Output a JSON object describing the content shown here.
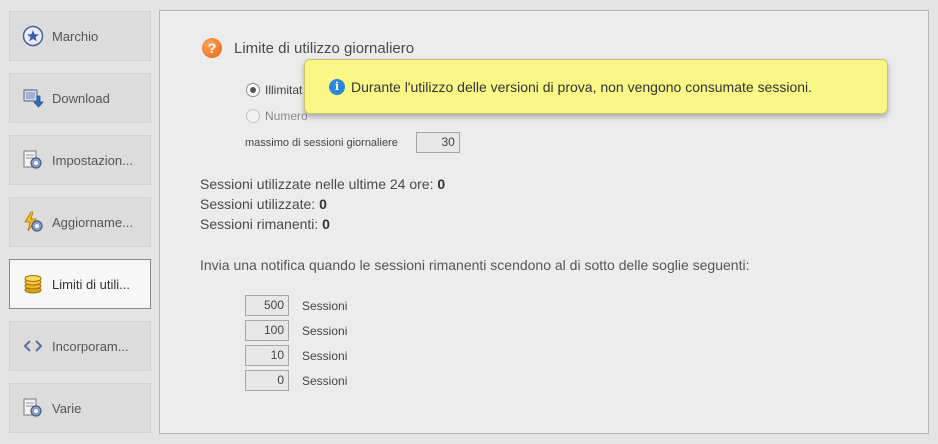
{
  "sidebar": {
    "items": [
      {
        "label": "Marchio",
        "icon": "star-badge-icon"
      },
      {
        "label": "Download",
        "icon": "download-icon"
      },
      {
        "label": "Impostazion...",
        "icon": "settings-gear-icon"
      },
      {
        "label": "Aggiorname...",
        "icon": "update-lightning-icon"
      },
      {
        "label": "Limiti di utili...",
        "icon": "coins-icon",
        "active": true
      },
      {
        "label": "Incorporam...",
        "icon": "embed-code-icon"
      },
      {
        "label": "Varie",
        "icon": "misc-gear-icon"
      }
    ]
  },
  "main": {
    "section_title": "Limite di utilizzo giornaliero",
    "radio_unlimited": "Illimitat",
    "radio_number": "Numero",
    "max_label": "massimo di sessioni giornaliere",
    "max_value": "30",
    "stats": {
      "last24_label": "Sessioni utilizzate nelle ultime 24 ore:",
      "last24_value": "0",
      "used_label": "Sessioni utilizzate:",
      "used_value": "0",
      "remaining_label": "Sessioni rimanenti:",
      "remaining_value": "0"
    },
    "notify_text": "Invia una notifica quando le sessioni rimanenti scendono al di sotto delle soglie seguenti:",
    "thresholds": [
      {
        "value": "500",
        "unit": "Sessioni"
      },
      {
        "value": "100",
        "unit": "Sessioni"
      },
      {
        "value": "10",
        "unit": "Sessioni"
      },
      {
        "value": "0",
        "unit": "Sessioni"
      }
    ]
  },
  "tooltip": {
    "text": "Durante l'utilizzo delle versioni di prova, non vengono consumate sessioni."
  },
  "colors": {
    "tooltip_bg": "#fbf787",
    "help_icon": "#e4650f",
    "info_icon": "#2a86d9"
  }
}
